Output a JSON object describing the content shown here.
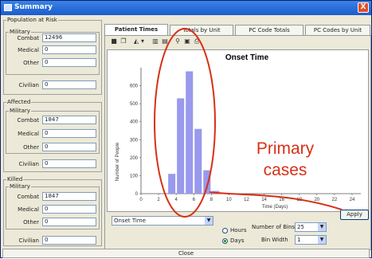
{
  "window": {
    "title": "Summary",
    "close_glyph": "X"
  },
  "population": {
    "legend": "Population at Risk",
    "military_legend": "Military",
    "combat_label": "Combat",
    "combat_value": "12496",
    "medical_label": "Medical",
    "medical_value": "0",
    "other_label": "Other",
    "other_value": "0",
    "civilian_label": "Civilian",
    "civilian_value": "0"
  },
  "affected": {
    "legend": "Affected",
    "military_legend": "Military",
    "combat_label": "Combat",
    "combat_value": "1847",
    "medical_label": "Medical",
    "medical_value": "0",
    "other_label": "Other",
    "other_value": "0",
    "civilian_label": "Civilian",
    "civilian_value": "0"
  },
  "killed": {
    "legend": "Killed",
    "military_legend": "Military",
    "combat_label": "Combat",
    "combat_value": "1847",
    "medical_label": "Medical",
    "medical_value": "0",
    "other_label": "Other",
    "other_value": "0",
    "civilian_label": "Civilian",
    "civilian_value": "0"
  },
  "tabs": [
    "Patient Times",
    "Totals by Unit",
    "PC Code Totals",
    "PC Codes by Unit"
  ],
  "toolbar_icons": [
    "save-icon",
    "copy-icon",
    "fill-color-icon",
    "dropdown-arrow-icon",
    "grid-vertical-icon",
    "grid-horizontal-icon",
    "zoom-icon",
    "print-preview-icon",
    "print-icon"
  ],
  "chart_data": {
    "type": "bar",
    "title": "Onset Time",
    "xlabel": "Time (Days)",
    "ylabel": "Number of People",
    "x": [
      3.5,
      4.5,
      5.5,
      6.5,
      7.5,
      8.5
    ],
    "values": [
      110,
      530,
      680,
      360,
      130,
      15
    ],
    "xlim": [
      0,
      25
    ],
    "ylim": [
      0,
      700
    ],
    "x_ticks": [
      "0",
      "2",
      "4",
      "6",
      "8",
      "10",
      "12",
      "14",
      "16",
      "18",
      "20",
      "22",
      "24"
    ],
    "y_ticks": [
      "0",
      "100",
      "200",
      "300",
      "400",
      "500",
      "600"
    ],
    "bar_color": "#9999ee",
    "annotation": "Primary\ncases",
    "annotation_color": "#d83018"
  },
  "controls": {
    "series_select": "Onset Time",
    "hours_label": "Hours",
    "days_label": "Days",
    "selected_unit": "Days",
    "num_bins_label": "Number of Bins",
    "num_bins_value": "25",
    "bin_width_label": "Bin Width",
    "bin_width_value": "1",
    "apply_label": "Apply"
  },
  "close_label": "Close"
}
